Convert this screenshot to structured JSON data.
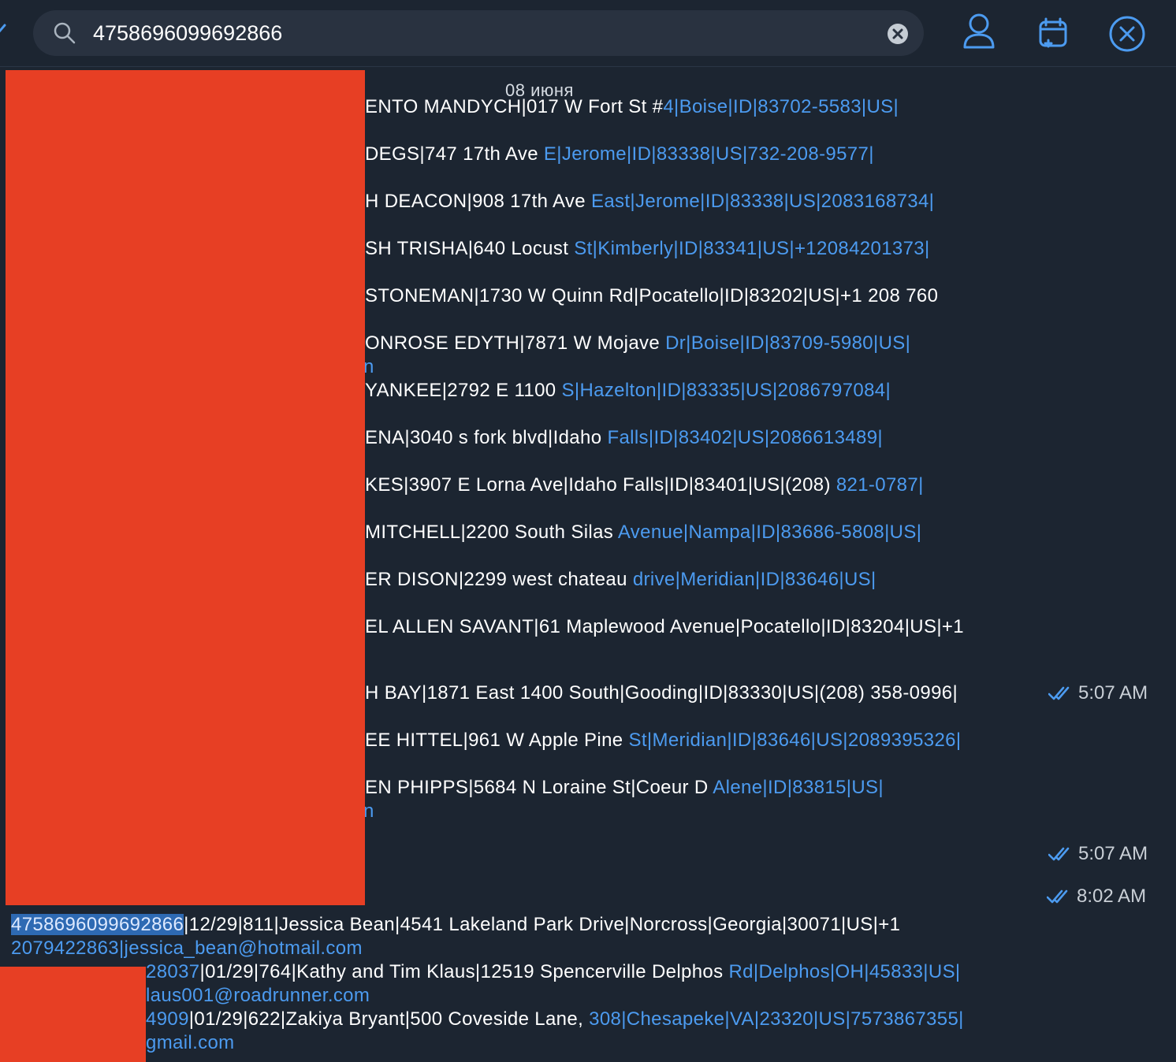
{
  "search": {
    "query": "4758696099692866"
  },
  "date_divider": "08 июня",
  "lines": [
    {
      "plain": "ENTO MANDYCH|017 W Fort St #",
      "link": "4|Boise|ID|83702-5583|US|"
    },
    {
      "plain": "DEGS|747 17th Ave ",
      "link": "E|Jerome|ID|83338|US|732-208-9577|"
    },
    {
      "plain": "H DEACON|908 17th Ave ",
      "link": "East|Jerome|ID|83338|US|2083168734|"
    },
    {
      "plain": "SH TRISHA|640 Locust ",
      "link": "St|Kimberly|ID|83341|US|+12084201373|"
    },
    {
      "plain": "STONEMAN|1730 W Quinn Rd|Pocatello|ID|83202|US|+1 208 760",
      "link": ""
    },
    {
      "plain": "ONROSE EDYTH|7871 W Mojave ",
      "link": "Dr|Boise|ID|83709-5980|US|"
    },
    {
      "plain": "YANKEE|2792 E 1100 ",
      "link": "S|Hazelton|ID|83335|US|2086797084|"
    },
    {
      "plain": "ENA|3040  s fork blvd|Idaho ",
      "link": "Falls|ID|83402|US|2086613489|"
    },
    {
      "plain": "KES|3907 E Lorna Ave|Idaho Falls|ID|83401|US|(208) ",
      "link": "821-0787|"
    },
    {
      "plain": "MITCHELL|2200 South Silas ",
      "link": "Avenue|Nampa|ID|83686-5808|US|"
    },
    {
      "plain": "ER DISON|2299 west chateau ",
      "link": "drive|Meridian|ID|83646|US|"
    },
    {
      "plain": "EL ALLEN SAVANT|61 Maplewood Avenue|Pocatello|ID|83204|US|+1",
      "link": ""
    },
    {
      "plain": "H BAY|1871 East 1400 South|Gooding|ID|83330|US|(208) 358-0996|",
      "link": ""
    },
    {
      "plain": "EE HITTEL|961 W Apple Pine ",
      "link": "St|Meridian|ID|83646|US|2089395326|"
    },
    {
      "plain": "EN PHIPPS|5684 N Loraine St|Coeur D ",
      "link": "Alene|ID|83815|US|"
    }
  ],
  "stray_links": [
    "n",
    "n"
  ],
  "times": [
    "5:07 AM",
    "5:07 AM",
    "8:02 AM"
  ],
  "bottom": {
    "line1_match": "4758696099692866",
    "line1_rest": "|12/29|811|Jessica Bean|4541 Lakeland Park Drive|Norcross|Georgia|30071|US|+1",
    "line2_link": "2079422863|jessica_bean@hotmail.com",
    "line3_link": "28037",
    "line3_plain": "|01/29|764|Kathy and Tim Klaus|12519 Spencerville Delphos ",
    "line3_link2": "Rd|Delphos|OH|45833|US|",
    "line4_link": "laus001@roadrunner.com",
    "line5_link": "4909",
    "line5_plain": "|01/29|622|Zakiya Bryant|500 Coveside Lane, ",
    "line5_link2": "308|Chesapeke|VA|23320|US|7573867355|",
    "line6_link": "gmail.com"
  },
  "colors": {
    "background": "#1c2531",
    "link": "#4c9bf0",
    "redaction": "#e73f24",
    "search_bg": "#293240"
  },
  "icons": [
    "checkmark-icon",
    "search-icon",
    "clear-icon",
    "profile-icon",
    "schedule-icon",
    "close-circle-icon",
    "double-check-icon"
  ]
}
